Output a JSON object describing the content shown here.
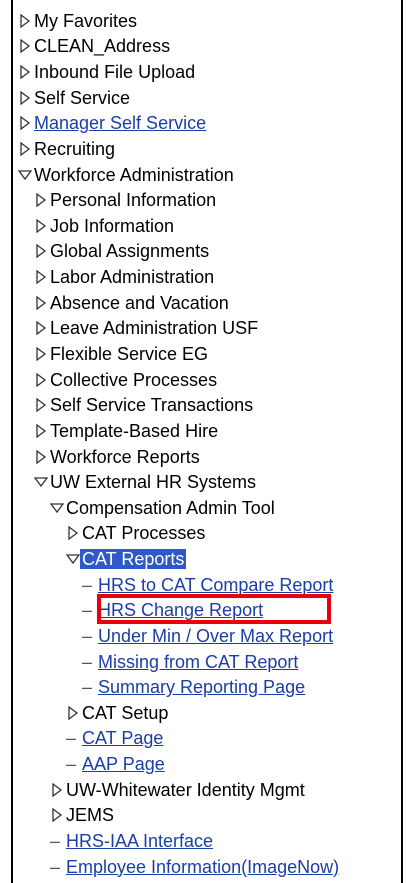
{
  "menu": {
    "items": [
      {
        "label": "My Favorites",
        "level": 0,
        "glyph": "closed",
        "link": false
      },
      {
        "label": "CLEAN_Address",
        "level": 0,
        "glyph": "closed",
        "link": false
      },
      {
        "label": "Inbound File Upload",
        "level": 0,
        "glyph": "closed",
        "link": false
      },
      {
        "label": "Self Service",
        "level": 0,
        "glyph": "closed",
        "link": false
      },
      {
        "label": "Manager Self Service",
        "level": 0,
        "glyph": "closed",
        "link": true
      },
      {
        "label": "Recruiting",
        "level": 0,
        "glyph": "closed",
        "link": false
      },
      {
        "label": "Workforce Administration",
        "level": 0,
        "glyph": "open",
        "link": false
      },
      {
        "label": "Personal Information",
        "level": 1,
        "glyph": "closed",
        "link": false
      },
      {
        "label": "Job Information",
        "level": 1,
        "glyph": "closed",
        "link": false
      },
      {
        "label": "Global Assignments",
        "level": 1,
        "glyph": "closed",
        "link": false
      },
      {
        "label": "Labor Administration",
        "level": 1,
        "glyph": "closed",
        "link": false
      },
      {
        "label": "Absence and Vacation",
        "level": 1,
        "glyph": "closed",
        "link": false
      },
      {
        "label": "Leave Administration USF",
        "level": 1,
        "glyph": "closed",
        "link": false
      },
      {
        "label": "Flexible Service EG",
        "level": 1,
        "glyph": "closed",
        "link": false
      },
      {
        "label": "Collective Processes",
        "level": 1,
        "glyph": "closed",
        "link": false
      },
      {
        "label": "Self Service Transactions",
        "level": 1,
        "glyph": "closed",
        "link": false
      },
      {
        "label": "Template-Based Hire",
        "level": 1,
        "glyph": "closed",
        "link": false
      },
      {
        "label": "Workforce Reports",
        "level": 1,
        "glyph": "closed",
        "link": false
      },
      {
        "label": "UW External HR Systems",
        "level": 1,
        "glyph": "open",
        "link": false
      },
      {
        "label": "Compensation Admin Tool",
        "level": 2,
        "glyph": "open",
        "link": false
      },
      {
        "label": "CAT Processes",
        "level": 3,
        "glyph": "closed",
        "link": false
      },
      {
        "label": "CAT Reports",
        "level": 3,
        "glyph": "open",
        "link": false,
        "selected": true
      },
      {
        "label": "HRS to CAT Compare Report",
        "level": 4,
        "glyph": "dash",
        "link": true
      },
      {
        "label": "HRS Change Report",
        "level": 4,
        "glyph": "dash",
        "link": true,
        "highlighted": true
      },
      {
        "label": "Under Min / Over Max Report",
        "level": 4,
        "glyph": "dash",
        "link": true
      },
      {
        "label": "Missing from CAT Report",
        "level": 4,
        "glyph": "dash",
        "link": true
      },
      {
        "label": "Summary Reporting Page",
        "level": 4,
        "glyph": "dash",
        "link": true
      },
      {
        "label": "CAT Setup",
        "level": 3,
        "glyph": "closed",
        "link": false
      },
      {
        "label": "CAT Page",
        "level": 3,
        "glyph": "dash",
        "link": true
      },
      {
        "label": "AAP Page",
        "level": 3,
        "glyph": "dash",
        "link": true
      },
      {
        "label": "UW-Whitewater Identity Mgmt",
        "level": 2,
        "glyph": "closed",
        "link": false
      },
      {
        "label": "JEMS",
        "level": 2,
        "glyph": "closed",
        "link": false
      },
      {
        "label": "HRS-IAA Interface",
        "level": 2,
        "glyph": "dash",
        "link": true
      },
      {
        "label": "Employee Information(ImageNow)",
        "level": 2,
        "glyph": "dash",
        "link": true
      }
    ]
  },
  "colors": {
    "link": "#1a3ea8",
    "selected_bg": "#2f59c9",
    "highlight_border": "#e8000b"
  },
  "icons": {
    "closed": "triangle-right-icon",
    "open": "triangle-down-icon",
    "dash": "dash-bullet-icon"
  }
}
